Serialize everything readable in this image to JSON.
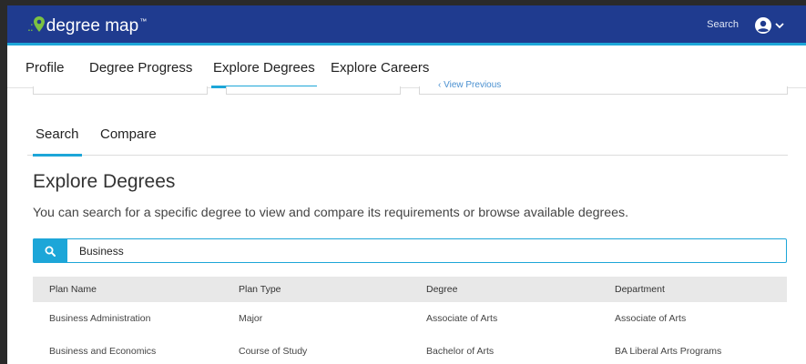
{
  "header": {
    "logo_text": "degree map",
    "logo_tm": "™",
    "search_label": "Search",
    "brand_color": "#1f3b8f",
    "accent_color": "#1da6d8"
  },
  "nav": {
    "items": [
      {
        "label": "Profile"
      },
      {
        "label": "Degree Progress"
      },
      {
        "label": "Explore Degrees"
      },
      {
        "label": "Explore Careers"
      }
    ],
    "active": "Explore Degrees"
  },
  "partial": {
    "link_text": "‹ View Previous"
  },
  "subtabs": {
    "items": [
      {
        "label": "Search"
      },
      {
        "label": "Compare"
      }
    ],
    "active": "Search"
  },
  "main": {
    "title": "Explore Degrees",
    "description": "You can search for a specific degree to view and compare its requirements or browse available degrees.",
    "search_value": "Business"
  },
  "table": {
    "columns": [
      "Plan Name",
      "Plan Type",
      "Degree",
      "Department"
    ],
    "rows": [
      [
        "Business Administration",
        "Major",
        "Associate of Arts",
        "Associate of Arts"
      ],
      [
        "Business and Economics",
        "Course of Study",
        "Bachelor of Arts",
        "BA Liberal Arts Programs"
      ]
    ]
  }
}
